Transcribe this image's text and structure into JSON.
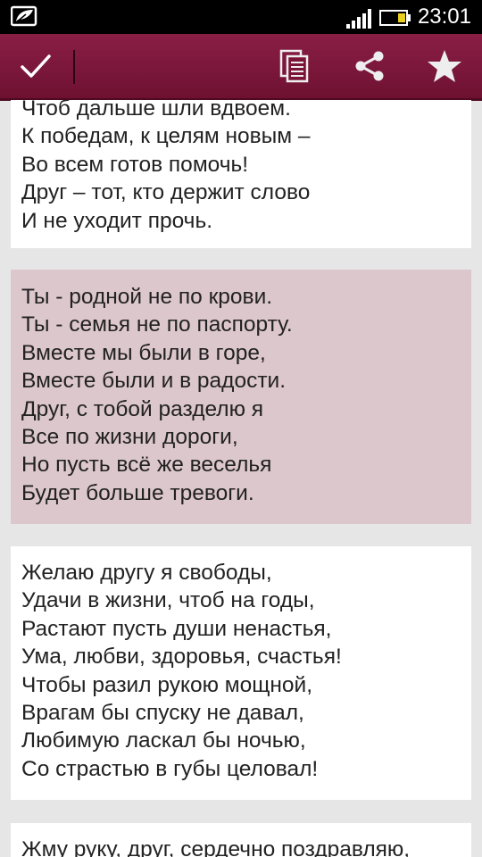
{
  "status_bar": {
    "time": "23:01"
  },
  "colors": {
    "action_bar": "#7c1639",
    "highlight_card": "#dcc7cd",
    "background": "#e6e6e6"
  },
  "icons": {
    "status_left": "eco-leaf-icon",
    "signal": "signal-icon",
    "battery": "battery-icon",
    "confirm": "check-icon",
    "copy": "copy-icon",
    "share": "share-icon",
    "favorite": "star-icon"
  },
  "poems": [
    {
      "lines": [
        "Чтоб дальше шли вдвоем.",
        "К победам, к целям новым –",
        "Во всем готов помочь!",
        "Друг – тот, кто держит слово",
        "И не уходит прочь."
      ]
    },
    {
      "lines": [
        "Ты - родной не по крови.",
        "Ты - семья не по паспорту.",
        "Вместе мы были в горе,",
        "Вместе были и в радости.",
        "Друг, с тобой разделю я",
        "Все по жизни дороги,",
        "Но пусть всё же веселья",
        "Будет больше тревоги."
      ]
    },
    {
      "lines": [
        "Желаю другу я свободы,",
        "Удачи в жизни, чтоб на годы,",
        "Растают пусть души ненастья,",
        "Ума, любви, здоровья, счастья!",
        "Чтобы разил рукою мощной,",
        "Врагам бы спуску не давал,",
        "Любимую ласкал бы ночью,",
        "Со страстью в губы целовал!"
      ]
    },
    {
      "lines": [
        "Жму руку, друг, сердечно поздравляю,"
      ]
    }
  ]
}
